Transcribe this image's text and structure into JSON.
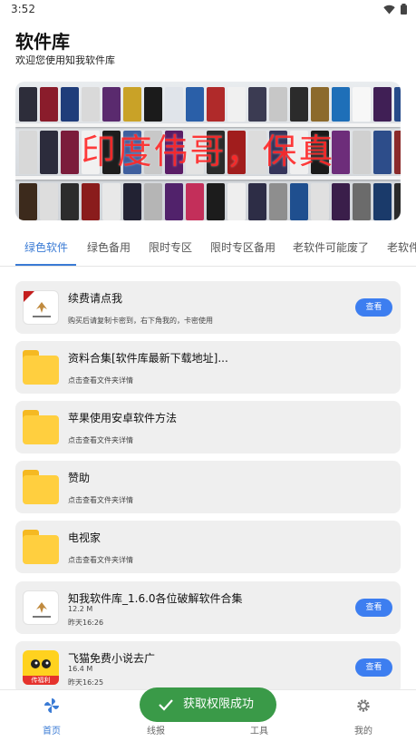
{
  "status_bar": {
    "time": "3:52"
  },
  "header": {
    "title": "软件库",
    "subtitle": "欢迎您使用知我软件库"
  },
  "banner": {
    "overlay_text": "印度伟哥，保真"
  },
  "tabs": [
    {
      "label": "绿色软件",
      "active": true
    },
    {
      "label": "绿色备用"
    },
    {
      "label": "限时专区"
    },
    {
      "label": "限时专区备用"
    },
    {
      "label": "老软件可能废了"
    },
    {
      "label": "老软件"
    }
  ],
  "list": [
    {
      "title": "续费请点我",
      "desc": "购买后请复制卡密到，右下角我的，卡密使用",
      "button": "查看",
      "icon": "app-logo-icon"
    },
    {
      "title": "资料合集[软件库最新下载地址]...",
      "desc": "点击查看文件夹详情",
      "icon": "folder-icon"
    },
    {
      "title": "苹果使用安卓软件方法",
      "desc": "点击查看文件夹详情",
      "icon": "folder-icon"
    },
    {
      "title": "赞助",
      "desc": "点击查看文件夹详情",
      "icon": "folder-icon"
    },
    {
      "title": "电视家",
      "desc": "点击查看文件夹详情",
      "icon": "folder-icon"
    },
    {
      "title": "知我软件库_1.6.0各位破解软件合集",
      "size": "12.2 M",
      "time": "昨天16:26",
      "button": "查看",
      "icon": "app-logo-icon"
    },
    {
      "title": "飞猫免费小说去广",
      "size": "16.4 M",
      "time": "昨天16:25",
      "button": "查看",
      "icon": "cat-app-icon",
      "badge": "传福利"
    }
  ],
  "bottom_nav": [
    {
      "label": "首页",
      "icon": "pinwheel-icon",
      "active": true
    },
    {
      "label": "线报",
      "icon": "news-icon"
    },
    {
      "label": "工具",
      "icon": "toolbox-icon"
    },
    {
      "label": "我的",
      "icon": "gear-icon"
    }
  ],
  "toast": {
    "text": "获取权限成功"
  },
  "colors": {
    "accent": "#3a7bd5",
    "button": "#3d7ef0",
    "toast": "#3a9a48",
    "folder": "#ffcf3f"
  }
}
